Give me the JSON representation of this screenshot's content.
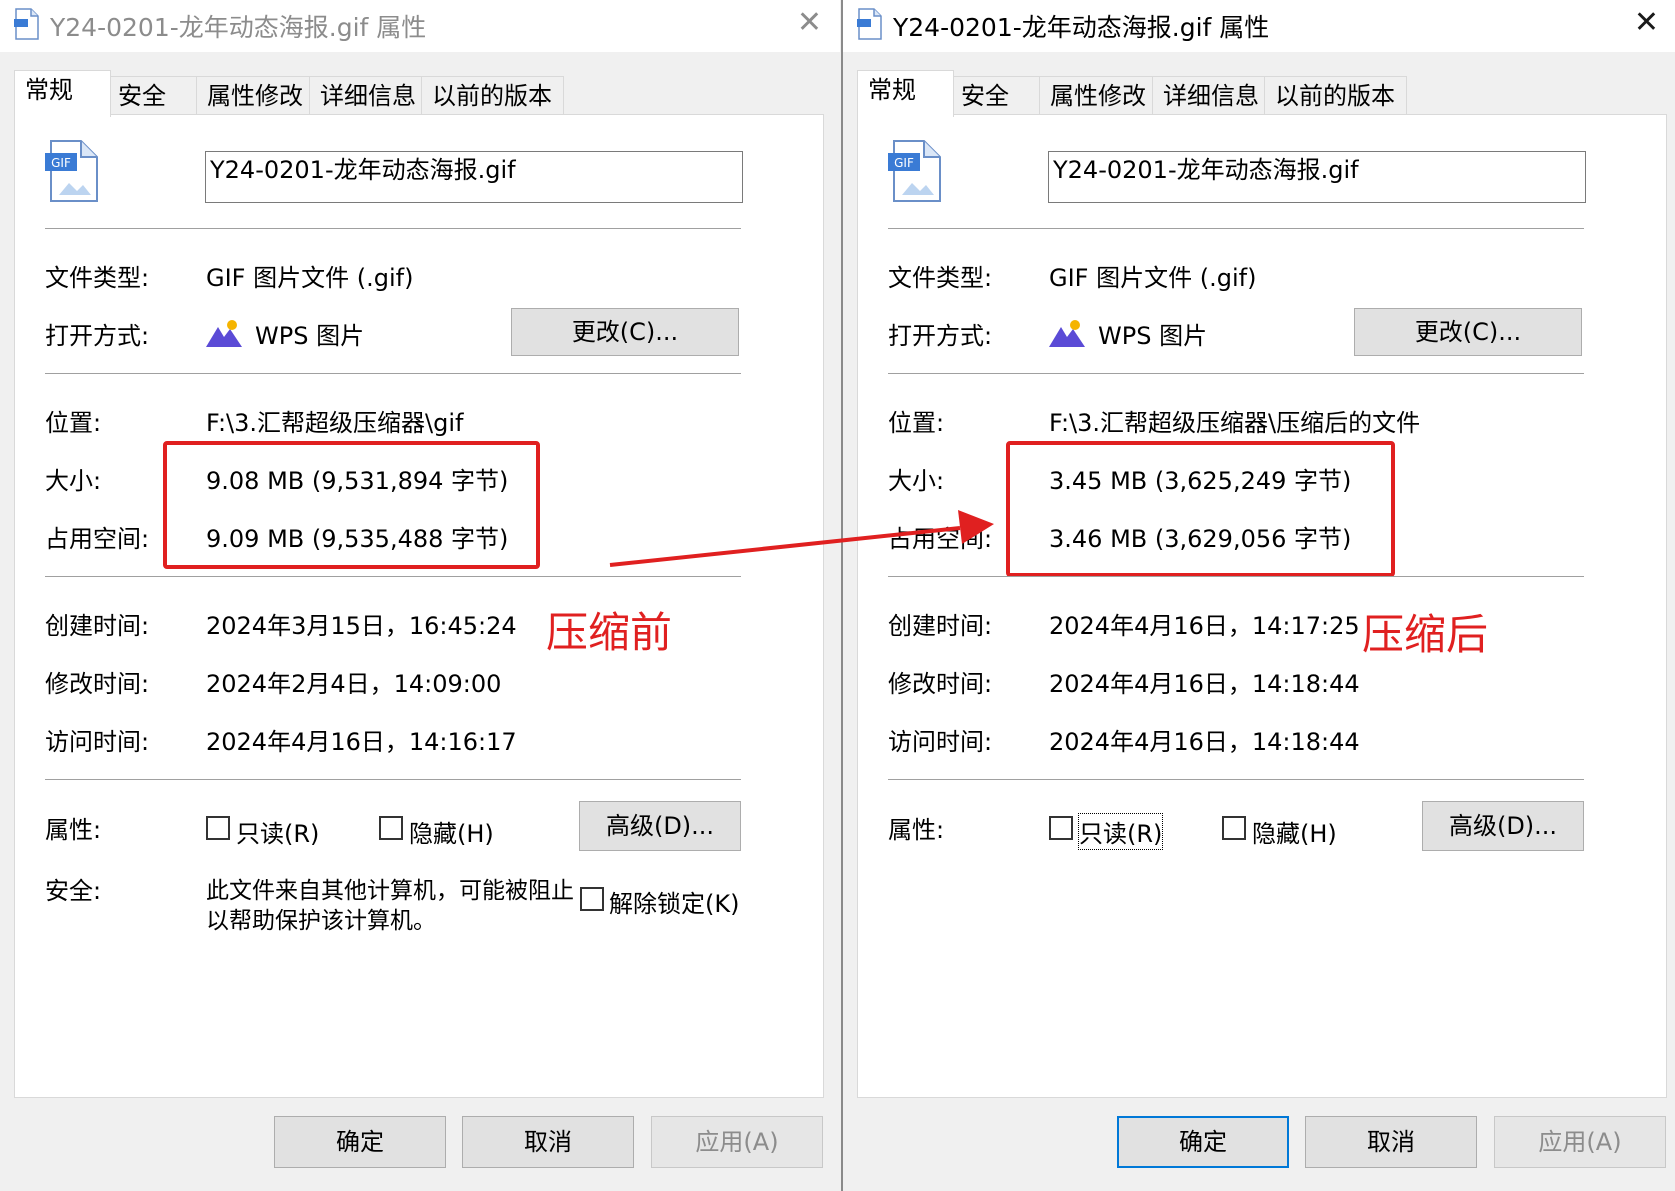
{
  "colors": {
    "accent": "#0078d7",
    "annotation": "#e02020",
    "panel": "#ffffff",
    "window": "#f0f0f0"
  },
  "icons": {
    "title": "gif-file-icon",
    "file": "gif-file-icon",
    "app": "wps-image-icon",
    "close": "close-icon"
  },
  "tabs": [
    "常规",
    "安全",
    "属性修改",
    "详细信息",
    "以前的版本"
  ],
  "labels": {
    "file_type": "文件类型:",
    "open_with": "打开方式:",
    "location": "位置:",
    "size": "大小:",
    "size_on_disk": "占用空间:",
    "created": "创建时间:",
    "modified": "修改时间:",
    "accessed": "访问时间:",
    "attributes": "属性:",
    "security": "安全:"
  },
  "gif_badge": "GIF",
  "close_glyph": "✕",
  "arrow_color": "#e02020",
  "left": {
    "title": "Y24-0201-龙年动态海报.gif 属性",
    "filename": "Y24-0201-龙年动态海报.gif",
    "file_type": "GIF 图片文件 (.gif)",
    "open_with": "WPS 图片",
    "change_button": "更改(C)...",
    "location": "F:\\3.汇帮超级压缩器\\gif",
    "size": "9.08 MB (9,531,894 字节)",
    "size_on_disk": "9.09 MB (9,535,488 字节)",
    "created": "2024年3月15日，16:45:24",
    "modified": "2024年2月4日，14:09:00",
    "accessed": "2024年4月16日，14:16:17",
    "readonly": "只读(R)",
    "hidden": "隐藏(H)",
    "advanced_button": "高级(D)...",
    "security_text_1": "此文件来自其他计算机，可能被阻止",
    "security_text_2": "以帮助保护该计算机。",
    "unblock": "解除锁定(K)",
    "annotation": "压缩前",
    "ok": "确定",
    "cancel": "取消",
    "apply": "应用(A)"
  },
  "right": {
    "title": "Y24-0201-龙年动态海报.gif 属性",
    "filename": "Y24-0201-龙年动态海报.gif",
    "file_type": "GIF 图片文件 (.gif)",
    "open_with": "WPS 图片",
    "change_button": "更改(C)...",
    "location": "F:\\3.汇帮超级压缩器\\压缩后的文件",
    "size": "3.45 MB (3,625,249 字节)",
    "size_on_disk": "3.46 MB (3,629,056 字节)",
    "created": "2024年4月16日，14:17:25",
    "modified": "2024年4月16日，14:18:44",
    "accessed": "2024年4月16日，14:18:44",
    "readonly": "只读(R)",
    "hidden": "隐藏(H)",
    "advanced_button": "高级(D)...",
    "annotation": "压缩后",
    "ok": "确定",
    "cancel": "取消",
    "apply": "应用(A)"
  }
}
